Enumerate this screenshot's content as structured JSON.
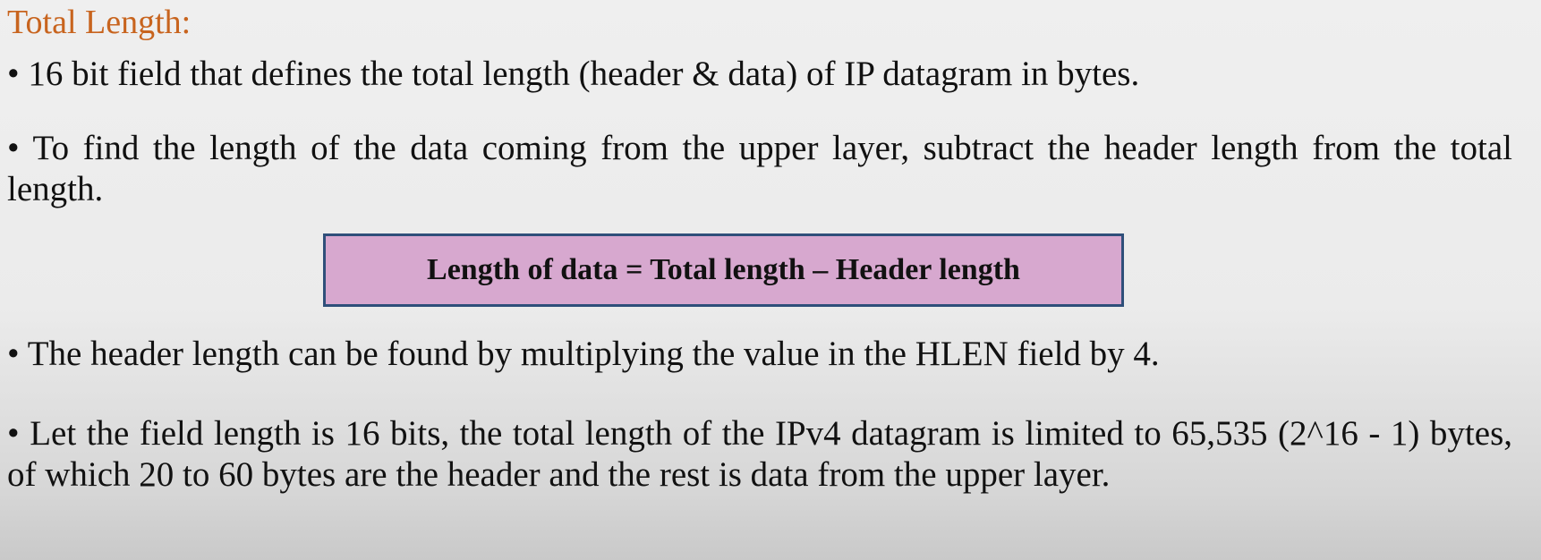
{
  "slide": {
    "title": "Total Length:",
    "bullets": [
      "• 16 bit field that defines the total length (header & data) of IP datagram in bytes.",
      "• To find the length of the data coming from the upper layer, subtract the header length from the total length.",
      "• The header length can be found by multiplying the value in the HLEN field by 4.",
      "• Let the field length is 16 bits, the total length of the IPv4 datagram is limited to 65,535 (2^16 - 1) bytes, of which 20 to 60 bytes are the header and the rest is data from the upper layer."
    ],
    "formula": "Length of data = Total length – Header length"
  },
  "colors": {
    "title": "#c8641e",
    "formula_background": "#d7a8cf",
    "formula_border": "#2f4f7a"
  }
}
